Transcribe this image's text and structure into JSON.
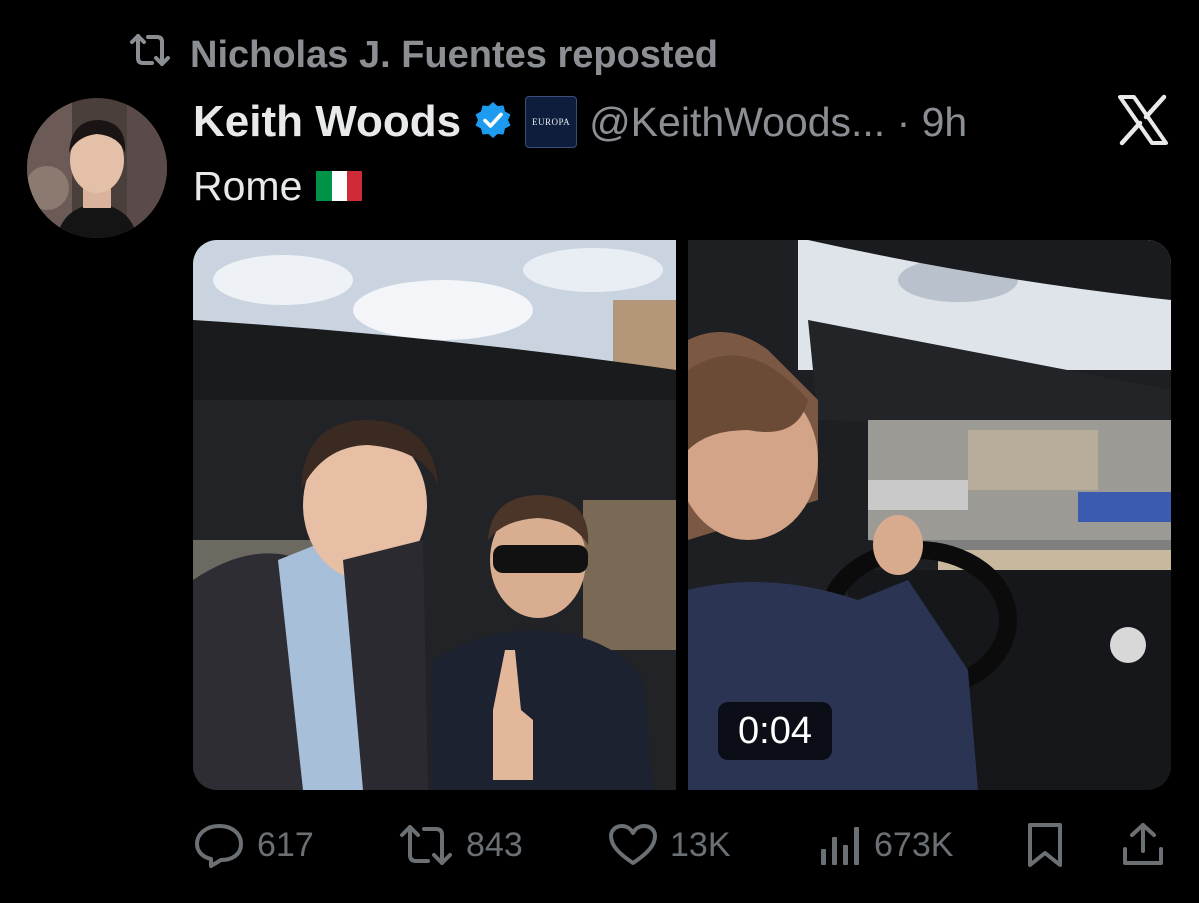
{
  "repost": {
    "icon": "repost-icon",
    "text": "Nicholas J. Fuentes reposted"
  },
  "author": {
    "display_name": "Keith Woods",
    "verified_icon": "verified-badge-icon",
    "affiliate_badge_text": "EUROPA",
    "handle_time": "@KeithWoods... · 9h"
  },
  "platform_icon": "x-logo-icon",
  "tweet": {
    "text": "Rome",
    "emoji": "italy-flag",
    "flag_colors": [
      "#009246",
      "#ffffff",
      "#ce2b37"
    ]
  },
  "media": {
    "video_duration": "0:04"
  },
  "actions": {
    "replies": "617",
    "reposts": "843",
    "likes": "13K",
    "views": "673K",
    "bookmark_icon": "bookmark-icon",
    "share_icon": "share-icon"
  },
  "colors": {
    "background": "#000000",
    "primary_text": "#e7e9ea",
    "secondary_text": "#8b8f94",
    "verified_blue": "#1d9bf0"
  }
}
